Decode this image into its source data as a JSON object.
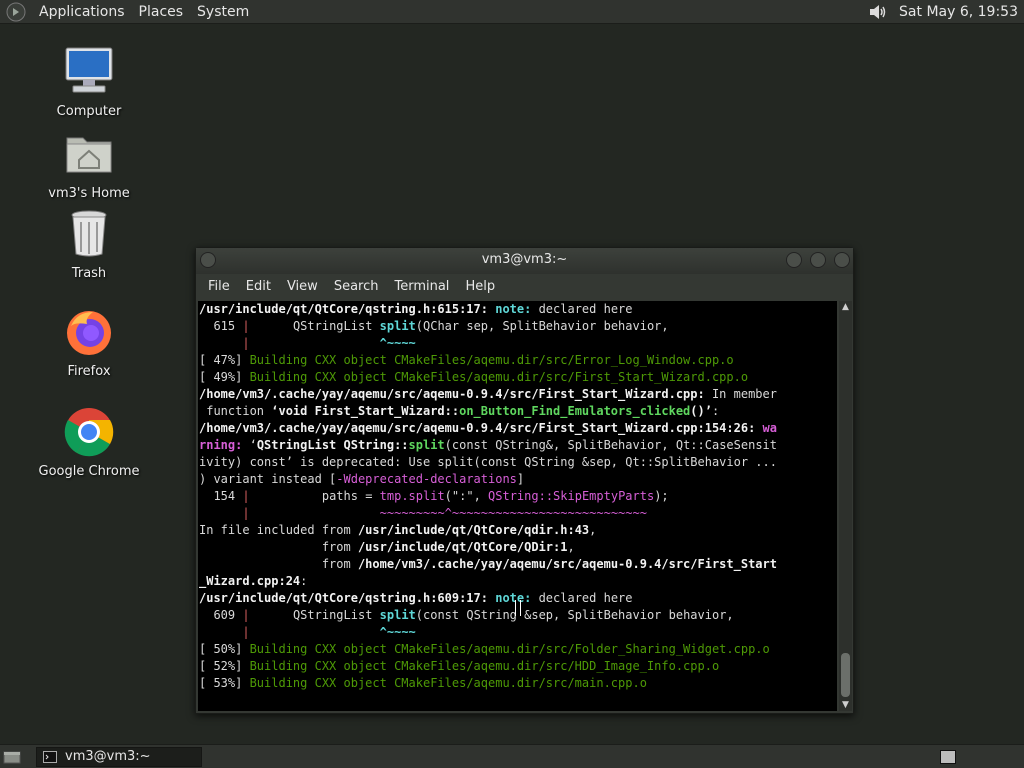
{
  "top_panel": {
    "menus": [
      "Applications",
      "Places",
      "System"
    ],
    "clock": "Sat May  6, 19:53"
  },
  "desktop_icons": [
    {
      "label": "Computer",
      "icon": "computer-icon"
    },
    {
      "label": "vm3's Home",
      "icon": "home-folder-icon"
    },
    {
      "label": "Trash",
      "icon": "trash-icon"
    },
    {
      "label": "Firefox",
      "icon": "firefox-icon"
    },
    {
      "label": "Google Chrome",
      "icon": "chrome-icon"
    }
  ],
  "terminal": {
    "title": "vm3@vm3:~",
    "menus": [
      "File",
      "Edit",
      "View",
      "Search",
      "Terminal",
      "Help"
    ],
    "lines": [
      [
        {
          "t": "/usr/include/qt/QtCore/qstring.h:615:17: ",
          "c": "b"
        },
        {
          "t": "note:",
          "c": "note"
        },
        {
          "t": " declared here",
          "c": ""
        }
      ],
      [
        {
          "t": "  615 ",
          "c": ""
        },
        {
          "t": "|",
          "c": "red"
        },
        {
          "t": "      QStringList ",
          "c": ""
        },
        {
          "t": "split",
          "c": "note"
        },
        {
          "t": "(QChar sep, SplitBehavior behavior,",
          "c": ""
        }
      ],
      [
        {
          "t": "      ",
          "c": ""
        },
        {
          "t": "|",
          "c": "red"
        },
        {
          "t": "                  ",
          "c": ""
        },
        {
          "t": "^~~~~",
          "c": "note"
        }
      ],
      [
        {
          "t": "[ 47%] ",
          "c": ""
        },
        {
          "t": "Building CXX object CMakeFiles/aqemu.dir/src/Error_Log_Window.cpp.o",
          "c": "dgrn"
        }
      ],
      [
        {
          "t": "[ 49%] ",
          "c": ""
        },
        {
          "t": "Building CXX object CMakeFiles/aqemu.dir/src/First_Start_Wizard.cpp.o",
          "c": "dgrn"
        }
      ],
      [
        {
          "t": "/home/vm3/.cache/yay/aqemu/src/aqemu-0.9.4/src/First_Start_Wizard.cpp:",
          "c": "b"
        },
        {
          "t": " In member",
          "c": ""
        }
      ],
      [
        {
          "t": " function ",
          "c": ""
        },
        {
          "t": "‘void First_Start_Wizard::",
          "c": "b"
        },
        {
          "t": "on_Button_Find_Emulators_clicked",
          "c": "grn"
        },
        {
          "t": "()’",
          "c": "b"
        },
        {
          "t": ":",
          "c": ""
        }
      ],
      [
        {
          "t": "/home/vm3/.cache/yay/aqemu/src/aqemu-0.9.4/src/First_Start_Wizard.cpp:154:26: ",
          "c": "b"
        },
        {
          "t": "wa",
          "c": "warn"
        }
      ],
      [
        {
          "t": "rning:",
          "c": "warn"
        },
        {
          "t": " ‘",
          "c": ""
        },
        {
          "t": "QStringList QString::",
          "c": "b"
        },
        {
          "t": "split",
          "c": "grn"
        },
        {
          "t": "(const QString&, SplitBehavior, Qt::CaseSensit",
          "c": ""
        }
      ],
      [
        {
          "t": "ivity) const’ is deprecated: Use split(const QString &sep, Qt::SplitBehavior ...",
          "c": ""
        }
      ],
      [
        {
          "t": ") variant instead [",
          "c": ""
        },
        {
          "t": "-Wdeprecated-declarations",
          "c": "mag"
        },
        {
          "t": "]",
          "c": ""
        }
      ],
      [
        {
          "t": "  154 ",
          "c": ""
        },
        {
          "t": "|",
          "c": "red"
        },
        {
          "t": "          paths = ",
          "c": ""
        },
        {
          "t": "tmp.split",
          "c": "mag"
        },
        {
          "t": "(\":\", ",
          "c": ""
        },
        {
          "t": "QString::SkipEmptyParts",
          "c": "mag"
        },
        {
          "t": ");",
          "c": ""
        }
      ],
      [
        {
          "t": "      ",
          "c": ""
        },
        {
          "t": "|",
          "c": "red"
        },
        {
          "t": "                  ",
          "c": ""
        },
        {
          "t": "~~~~~~~~~^~~~~~~~~~~~~~~~~~~~~~~~~~~~",
          "c": "mag"
        }
      ],
      [
        {
          "t": "In file included from ",
          "c": ""
        },
        {
          "t": "/usr/include/qt/QtCore/qdir.h:43",
          "c": "b"
        },
        {
          "t": ",",
          "c": ""
        }
      ],
      [
        {
          "t": "                 from ",
          "c": ""
        },
        {
          "t": "/usr/include/qt/QtCore/QDir:1",
          "c": "b"
        },
        {
          "t": ",",
          "c": ""
        }
      ],
      [
        {
          "t": "                 from ",
          "c": ""
        },
        {
          "t": "/home/vm3/.cache/yay/aqemu/src/aqemu-0.9.4/src/First_Start",
          "c": "b"
        }
      ],
      [
        {
          "t": "_Wizard.cpp:24",
          "c": "b"
        },
        {
          "t": ":",
          "c": ""
        }
      ],
      [
        {
          "t": "/usr/include/qt/QtCore/qstring.h:609:17: ",
          "c": "b"
        },
        {
          "t": "note:",
          "c": "note"
        },
        {
          "t": " declared here",
          "c": ""
        }
      ],
      [
        {
          "t": "  609 ",
          "c": ""
        },
        {
          "t": "|",
          "c": "red"
        },
        {
          "t": "      QStringList ",
          "c": ""
        },
        {
          "t": "split",
          "c": "note"
        },
        {
          "t": "(const QString &sep, SplitBehavior behavior,",
          "c": ""
        }
      ],
      [
        {
          "t": "      ",
          "c": ""
        },
        {
          "t": "|",
          "c": "red"
        },
        {
          "t": "                  ",
          "c": ""
        },
        {
          "t": "^~~~~",
          "c": "note"
        }
      ],
      [
        {
          "t": "[ 50%] ",
          "c": ""
        },
        {
          "t": "Building CXX object CMakeFiles/aqemu.dir/src/Folder_Sharing_Widget.cpp.o",
          "c": "dgrn"
        }
      ],
      [
        {
          "t": "[ 52%] ",
          "c": ""
        },
        {
          "t": "Building CXX object CMakeFiles/aqemu.dir/src/HDD_Image_Info.cpp.o",
          "c": "dgrn"
        }
      ],
      [
        {
          "t": "[ 53%] ",
          "c": ""
        },
        {
          "t": "Building CXX object CMakeFiles/aqemu.dir/src/main.cpp.o",
          "c": "dgrn"
        }
      ]
    ]
  },
  "taskbar": {
    "task_label": "vm3@vm3:~"
  },
  "colors": {
    "desktop_bg": "#232722",
    "panel_bg": "#30332f",
    "terminal_bg": "#000000",
    "note": "#5fd7d7",
    "warning": "#d75fd7",
    "build_green": "#4e9a06"
  }
}
